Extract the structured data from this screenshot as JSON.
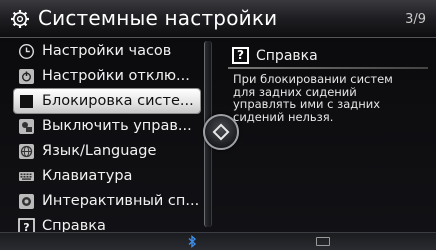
{
  "header": {
    "title": "Системные настройки",
    "page_indicator": "3/9",
    "icon": "gear-icon"
  },
  "menu": {
    "selected_index": 2,
    "items": [
      {
        "label": "Настройки часов",
        "icon": "clock-icon"
      },
      {
        "label": "Настройки отклю...",
        "icon": "power-settings-icon"
      },
      {
        "label": "Блокировка систе...",
        "icon": "lock-square-icon"
      },
      {
        "label": "Выключить управ...",
        "icon": "rear-control-off-icon"
      },
      {
        "label": "Язык/Language",
        "icon": "language-icon"
      },
      {
        "label": "Клавиатура",
        "icon": "keyboard-icon"
      },
      {
        "label": "Интерактивный сп...",
        "icon": "interactive-guide-icon"
      },
      {
        "label": "Справка",
        "icon": "help-icon"
      }
    ]
  },
  "help": {
    "title": "Справка",
    "icon": "help-icon",
    "lines": [
      "При блокировании систем",
      "для задних сидений",
      "управлять ими с задних",
      "сидений нельзя."
    ]
  },
  "status": {
    "bluetooth": "ʙ",
    "icons": [
      "bluetooth-icon",
      "status-indicator-icon"
    ]
  },
  "colors": {
    "selected_bg": "#ffffff",
    "text": "#ffffff",
    "bluetooth": "#3d8ce6"
  }
}
